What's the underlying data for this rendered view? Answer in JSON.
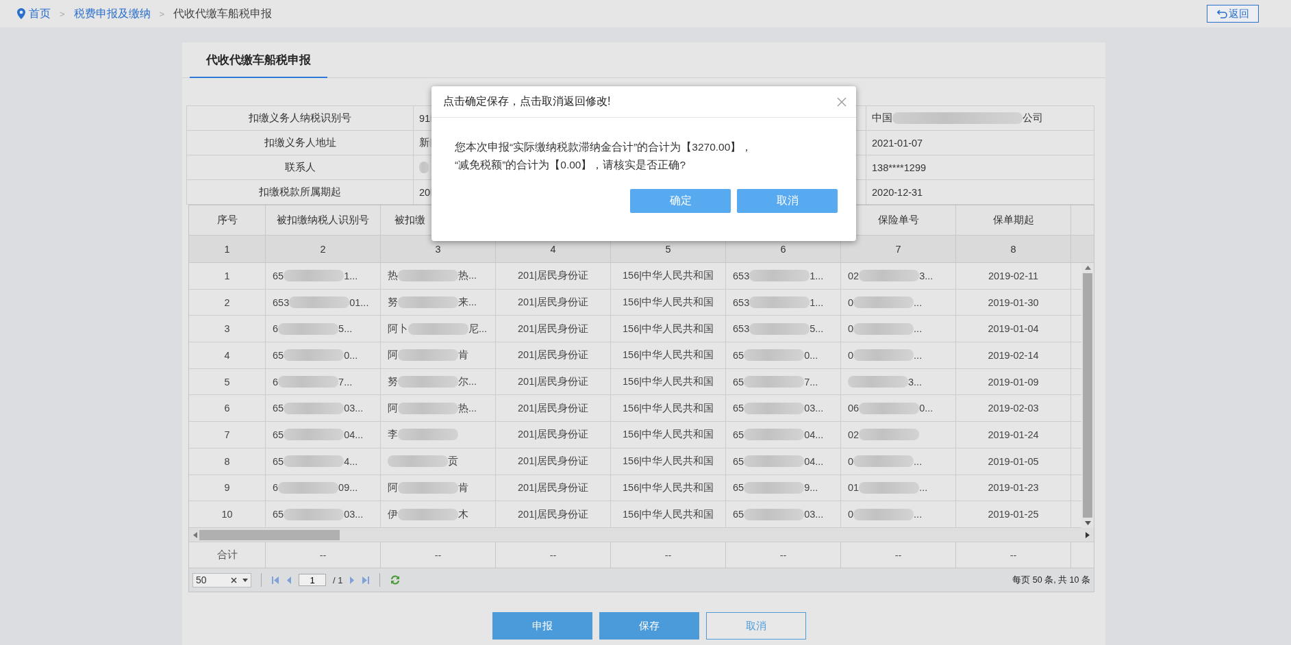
{
  "breadcrumb": {
    "separator": ">",
    "items": [
      {
        "label": "首页",
        "kind": "home"
      },
      {
        "label": "税费申报及缴纳",
        "kind": "link"
      },
      {
        "label": "代收代缴车船税申报",
        "kind": "current"
      }
    ]
  },
  "back_button": "返回",
  "tab": "代收代缴车船税申报",
  "info_rows": [
    {
      "label": "扣缴义务人纳税识别号",
      "value": {
        "kind": "masked",
        "start": "91"
      },
      "right": {
        "kind": "masked",
        "start": "中国",
        "end": "公司"
      }
    },
    {
      "label": "扣缴义务人地址",
      "value": {
        "kind": "masked",
        "start": "新"
      },
      "right": {
        "kind": "plain",
        "text": "2021-01-07"
      }
    },
    {
      "label": "联系人",
      "value": {
        "kind": "masked"
      },
      "right": {
        "kind": "plain",
        "text": "138****1299"
      }
    },
    {
      "label": "扣缴税款所属期起",
      "value": {
        "kind": "masked",
        "start": "20"
      },
      "right": {
        "kind": "plain",
        "text": "2020-12-31"
      }
    }
  ],
  "table": {
    "columns": [
      {
        "label": "序号"
      },
      {
        "label": "被扣缴纳税人识别号"
      },
      {
        "label": "被扣缴"
      },
      {},
      {},
      {},
      {
        "label": "保险单号"
      },
      {
        "label": "保单期起"
      }
    ],
    "column_numbers": [
      "1",
      "2",
      "3",
      "4",
      "5",
      "6",
      "7",
      "8"
    ],
    "rows": [
      [
        {
          "kind": "plain",
          "text": "1"
        },
        {
          "kind": "masked",
          "start": "65",
          "end": "1..."
        },
        {
          "kind": "masked",
          "start": "热",
          "end": "热..."
        },
        {
          "kind": "plain",
          "text": "201|居民身份证"
        },
        {
          "kind": "plain",
          "text": "156|中华人民共和国"
        },
        {
          "kind": "masked",
          "start": "653",
          "end": "1..."
        },
        {
          "kind": "masked",
          "start": "02",
          "end": "3..."
        },
        {
          "kind": "plain",
          "text": "2019-02-11"
        }
      ],
      [
        {
          "kind": "plain",
          "text": "2"
        },
        {
          "kind": "masked",
          "start": "653",
          "end": "01..."
        },
        {
          "kind": "masked",
          "start": "努",
          "end": "来..."
        },
        {
          "kind": "plain",
          "text": "201|居民身份证"
        },
        {
          "kind": "plain",
          "text": "156|中华人民共和国"
        },
        {
          "kind": "masked",
          "start": "653",
          "end": "1..."
        },
        {
          "kind": "masked",
          "start": "0",
          "end": "..."
        },
        {
          "kind": "plain",
          "text": "2019-01-30"
        }
      ],
      [
        {
          "kind": "plain",
          "text": "3"
        },
        {
          "kind": "masked",
          "start": "6",
          "end": "5..."
        },
        {
          "kind": "masked",
          "start": "阿卜",
          "end": "尼..."
        },
        {
          "kind": "plain",
          "text": "201|居民身份证"
        },
        {
          "kind": "plain",
          "text": "156|中华人民共和国"
        },
        {
          "kind": "masked",
          "start": "653",
          "end": "5..."
        },
        {
          "kind": "masked",
          "start": "0",
          "end": "..."
        },
        {
          "kind": "plain",
          "text": "2019-01-04"
        }
      ],
      [
        {
          "kind": "plain",
          "text": "4"
        },
        {
          "kind": "masked",
          "start": "65",
          "end": "0..."
        },
        {
          "kind": "masked",
          "start": "阿",
          "end": "肯"
        },
        {
          "kind": "plain",
          "text": "201|居民身份证"
        },
        {
          "kind": "plain",
          "text": "156|中华人民共和国"
        },
        {
          "kind": "masked",
          "start": "65",
          "end": "0..."
        },
        {
          "kind": "masked",
          "start": "0",
          "end": "..."
        },
        {
          "kind": "plain",
          "text": "2019-02-14"
        }
      ],
      [
        {
          "kind": "plain",
          "text": "5"
        },
        {
          "kind": "masked",
          "start": "6",
          "end": "7..."
        },
        {
          "kind": "masked",
          "start": "努",
          "end": "尔..."
        },
        {
          "kind": "plain",
          "text": "201|居民身份证"
        },
        {
          "kind": "plain",
          "text": "156|中华人民共和国"
        },
        {
          "kind": "masked",
          "start": "65",
          "end": "7..."
        },
        {
          "kind": "masked",
          "end": "3..."
        },
        {
          "kind": "plain",
          "text": "2019-01-09"
        }
      ],
      [
        {
          "kind": "plain",
          "text": "6"
        },
        {
          "kind": "masked",
          "start": "65",
          "end": "03..."
        },
        {
          "kind": "masked",
          "start": "阿",
          "end": "热..."
        },
        {
          "kind": "plain",
          "text": "201|居民身份证"
        },
        {
          "kind": "plain",
          "text": "156|中华人民共和国"
        },
        {
          "kind": "masked",
          "start": "65",
          "end": "03..."
        },
        {
          "kind": "masked",
          "start": "06",
          "end": "0..."
        },
        {
          "kind": "plain",
          "text": "2019-02-03"
        }
      ],
      [
        {
          "kind": "plain",
          "text": "7"
        },
        {
          "kind": "masked",
          "start": "65",
          "end": "04..."
        },
        {
          "kind": "masked",
          "start": "李"
        },
        {
          "kind": "plain",
          "text": "201|居民身份证"
        },
        {
          "kind": "plain",
          "text": "156|中华人民共和国"
        },
        {
          "kind": "masked",
          "start": "65",
          "end": "04..."
        },
        {
          "kind": "masked",
          "start": "02"
        },
        {
          "kind": "plain",
          "text": "2019-01-24"
        }
      ],
      [
        {
          "kind": "plain",
          "text": "8"
        },
        {
          "kind": "masked",
          "start": "65",
          "end": "4..."
        },
        {
          "kind": "masked",
          "end": "贡"
        },
        {
          "kind": "plain",
          "text": "201|居民身份证"
        },
        {
          "kind": "plain",
          "text": "156|中华人民共和国"
        },
        {
          "kind": "masked",
          "start": "65",
          "end": "04..."
        },
        {
          "kind": "masked",
          "start": "0",
          "end": "..."
        },
        {
          "kind": "plain",
          "text": "2019-01-05"
        }
      ],
      [
        {
          "kind": "plain",
          "text": "9"
        },
        {
          "kind": "masked",
          "start": "6",
          "end": "09..."
        },
        {
          "kind": "masked",
          "start": "阿",
          "end": "肯"
        },
        {
          "kind": "plain",
          "text": "201|居民身份证"
        },
        {
          "kind": "plain",
          "text": "156|中华人民共和国"
        },
        {
          "kind": "masked",
          "start": "65",
          "end": "9..."
        },
        {
          "kind": "masked",
          "start": "01",
          "end": "..."
        },
        {
          "kind": "plain",
          "text": "2019-01-23"
        }
      ],
      [
        {
          "kind": "plain",
          "text": "10"
        },
        {
          "kind": "masked",
          "start": "65",
          "end": "03..."
        },
        {
          "kind": "masked",
          "start": "伊",
          "end": "木"
        },
        {
          "kind": "plain",
          "text": "201|居民身份证"
        },
        {
          "kind": "plain",
          "text": "156|中华人民共和国"
        },
        {
          "kind": "masked",
          "start": "65",
          "end": "03..."
        },
        {
          "kind": "masked",
          "start": "0",
          "end": "..."
        },
        {
          "kind": "plain",
          "text": "2019-01-25"
        }
      ]
    ],
    "total_row": [
      "合计",
      "--",
      "--",
      "--",
      "--",
      "--",
      "--",
      "--"
    ]
  },
  "pager": {
    "page_size": "50",
    "page": "1",
    "total_pages": "/ 1",
    "summary": "每页 50 条, 共 10 条"
  },
  "buttons": [
    {
      "label": "申报",
      "kind": "primary"
    },
    {
      "label": "保存",
      "kind": "primary"
    },
    {
      "label": "取消",
      "kind": "secondary"
    }
  ],
  "dialog": {
    "title": "点击确定保存，点击取消返回修改!",
    "message": "您本次申报“实际缴纳税款滞纳金合计”的合计为【3270.00】，\n“减免税额”的合计为【0.00】，请核实是否正确?",
    "buttons": [
      {
        "label": "确定"
      },
      {
        "label": "取消"
      }
    ]
  }
}
